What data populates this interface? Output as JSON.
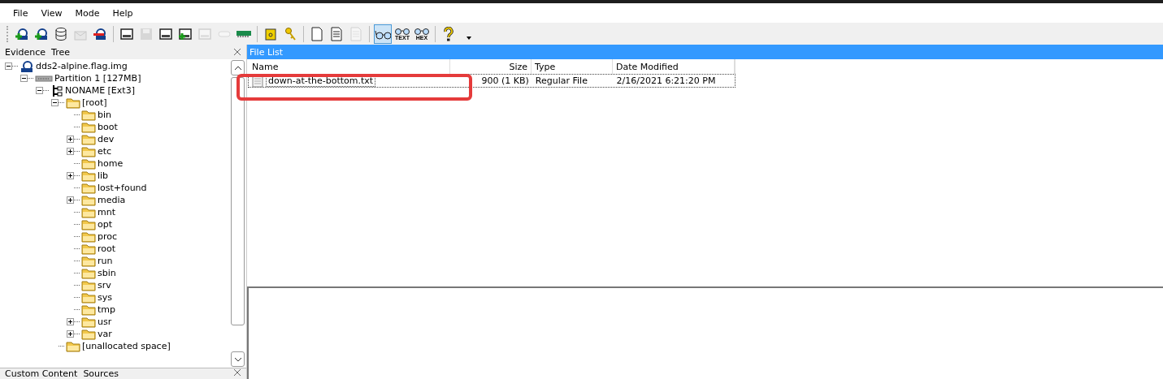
{
  "menu": [
    "File",
    "View",
    "Mode",
    "Help"
  ],
  "toolbar": [
    {
      "kind": "add-evidence",
      "disabled": false,
      "selected": false
    },
    {
      "kind": "refresh-evidence",
      "disabled": false,
      "selected": false
    },
    {
      "kind": "database",
      "disabled": false,
      "selected": false
    },
    {
      "kind": "export",
      "disabled": true,
      "selected": false
    },
    {
      "kind": "remove-evidence",
      "disabled": false,
      "selected": false
    },
    {
      "kind": "sep"
    },
    {
      "kind": "drive",
      "disabled": false,
      "selected": false
    },
    {
      "kind": "save",
      "disabled": true,
      "selected": false
    },
    {
      "kind": "drive",
      "disabled": false,
      "selected": false
    },
    {
      "kind": "drive-add",
      "disabled": false,
      "selected": false
    },
    {
      "kind": "drive",
      "disabled": true,
      "selected": false
    },
    {
      "kind": "slot",
      "disabled": true,
      "selected": false
    },
    {
      "kind": "memory",
      "disabled": false,
      "selected": false
    },
    {
      "kind": "sep"
    },
    {
      "kind": "safe",
      "disabled": false,
      "selected": false
    },
    {
      "kind": "key",
      "disabled": false,
      "selected": false
    },
    {
      "kind": "sep"
    },
    {
      "kind": "page",
      "disabled": false,
      "selected": false
    },
    {
      "kind": "doc",
      "disabled": false,
      "selected": false
    },
    {
      "kind": "doc",
      "disabled": true,
      "selected": false
    },
    {
      "kind": "sep"
    },
    {
      "kind": "glasses",
      "disabled": false,
      "selected": true
    },
    {
      "kind": "glasses-label",
      "label": "TEXT",
      "disabled": false,
      "selected": false
    },
    {
      "kind": "glasses-label",
      "label": "HEX",
      "disabled": false,
      "selected": false
    },
    {
      "kind": "sep"
    },
    {
      "kind": "help",
      "disabled": false,
      "selected": false
    }
  ],
  "evidence_panel": {
    "title": "Evidence  Tree",
    "tree": [
      {
        "label": "dds2-alpine.flag.img",
        "kind": "image",
        "expanded": true,
        "children": [
          {
            "label": "Partition 1 [127MB]",
            "kind": "partition",
            "expanded": true,
            "children": [
              {
                "label": "NONAME [Ext3]",
                "kind": "filesystem",
                "expanded": true,
                "children": [
                  {
                    "label": "[root]",
                    "kind": "folder",
                    "expanded": true,
                    "children": [
                      {
                        "label": "bin",
                        "kind": "folder"
                      },
                      {
                        "label": "boot",
                        "kind": "folder"
                      },
                      {
                        "label": "dev",
                        "kind": "folder",
                        "expanded": false
                      },
                      {
                        "label": "etc",
                        "kind": "folder",
                        "expanded": false
                      },
                      {
                        "label": "home",
                        "kind": "folder"
                      },
                      {
                        "label": "lib",
                        "kind": "folder",
                        "expanded": false
                      },
                      {
                        "label": "lost+found",
                        "kind": "folder"
                      },
                      {
                        "label": "media",
                        "kind": "folder",
                        "expanded": false
                      },
                      {
                        "label": "mnt",
                        "kind": "folder"
                      },
                      {
                        "label": "opt",
                        "kind": "folder"
                      },
                      {
                        "label": "proc",
                        "kind": "folder"
                      },
                      {
                        "label": "root",
                        "kind": "folder"
                      },
                      {
                        "label": "run",
                        "kind": "folder"
                      },
                      {
                        "label": "sbin",
                        "kind": "folder"
                      },
                      {
                        "label": "srv",
                        "kind": "folder"
                      },
                      {
                        "label": "sys",
                        "kind": "folder"
                      },
                      {
                        "label": "tmp",
                        "kind": "folder"
                      },
                      {
                        "label": "usr",
                        "kind": "folder",
                        "expanded": false
                      },
                      {
                        "label": "var",
                        "kind": "folder",
                        "expanded": false
                      }
                    ]
                  },
                  {
                    "label": "[unallocated space]",
                    "kind": "folder"
                  }
                ]
              }
            ]
          }
        ]
      }
    ]
  },
  "sources_panel": {
    "title": "Custom Content  Sources"
  },
  "file_list": {
    "title": "File List",
    "columns": [
      "Name",
      "Size",
      "Type",
      "Date Modified"
    ],
    "rows": [
      {
        "name": "down-at-the-bottom.txt",
        "size": "900 (1 KB)",
        "type": "Regular File",
        "date_modified": "2/16/2021 6:21:20 PM",
        "highlighted": true
      }
    ]
  }
}
